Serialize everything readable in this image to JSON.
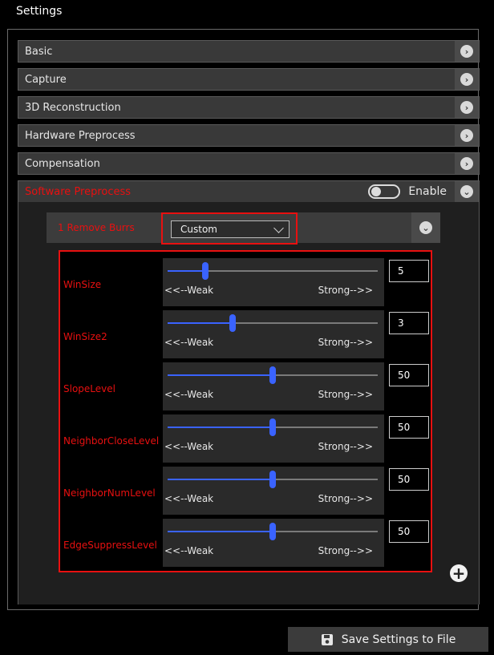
{
  "title": "Settings",
  "sections": [
    {
      "label": "Basic"
    },
    {
      "label": "Capture"
    },
    {
      "label": "3D Reconstruction"
    },
    {
      "label": "Hardware Preprocess"
    },
    {
      "label": "Compensation"
    }
  ],
  "software": {
    "label": "Software Preprocess",
    "enable_label": "Enable",
    "enabled": false
  },
  "remove_burrs": {
    "title": "1  Remove Burrs",
    "mode": "Custom",
    "weak_label": "<<--Weak",
    "strong_label": "Strong-->>",
    "params": [
      {
        "name": "WinSize",
        "value": "5",
        "fraction": 0.18
      },
      {
        "name": "WinSize2",
        "value": "3",
        "fraction": 0.31
      },
      {
        "name": "SlopeLevel",
        "value": "50",
        "fraction": 0.5
      },
      {
        "name": "NeighborCloseLevel",
        "value": "50",
        "fraction": 0.5
      },
      {
        "name": "NeighborNumLevel",
        "value": "50",
        "fraction": 0.5
      },
      {
        "name": "EdgeSuppressLevel",
        "value": "50",
        "fraction": 0.5
      }
    ]
  },
  "save_label": "Save Settings to File",
  "colors": {
    "accent": "#3a63ff",
    "highlight": "#e81010"
  },
  "icons": {
    "section_arrow": "chevron-right-icon",
    "expand": "chevron-down-icon",
    "add": "plus-icon",
    "save": "floppy-disk-icon"
  }
}
